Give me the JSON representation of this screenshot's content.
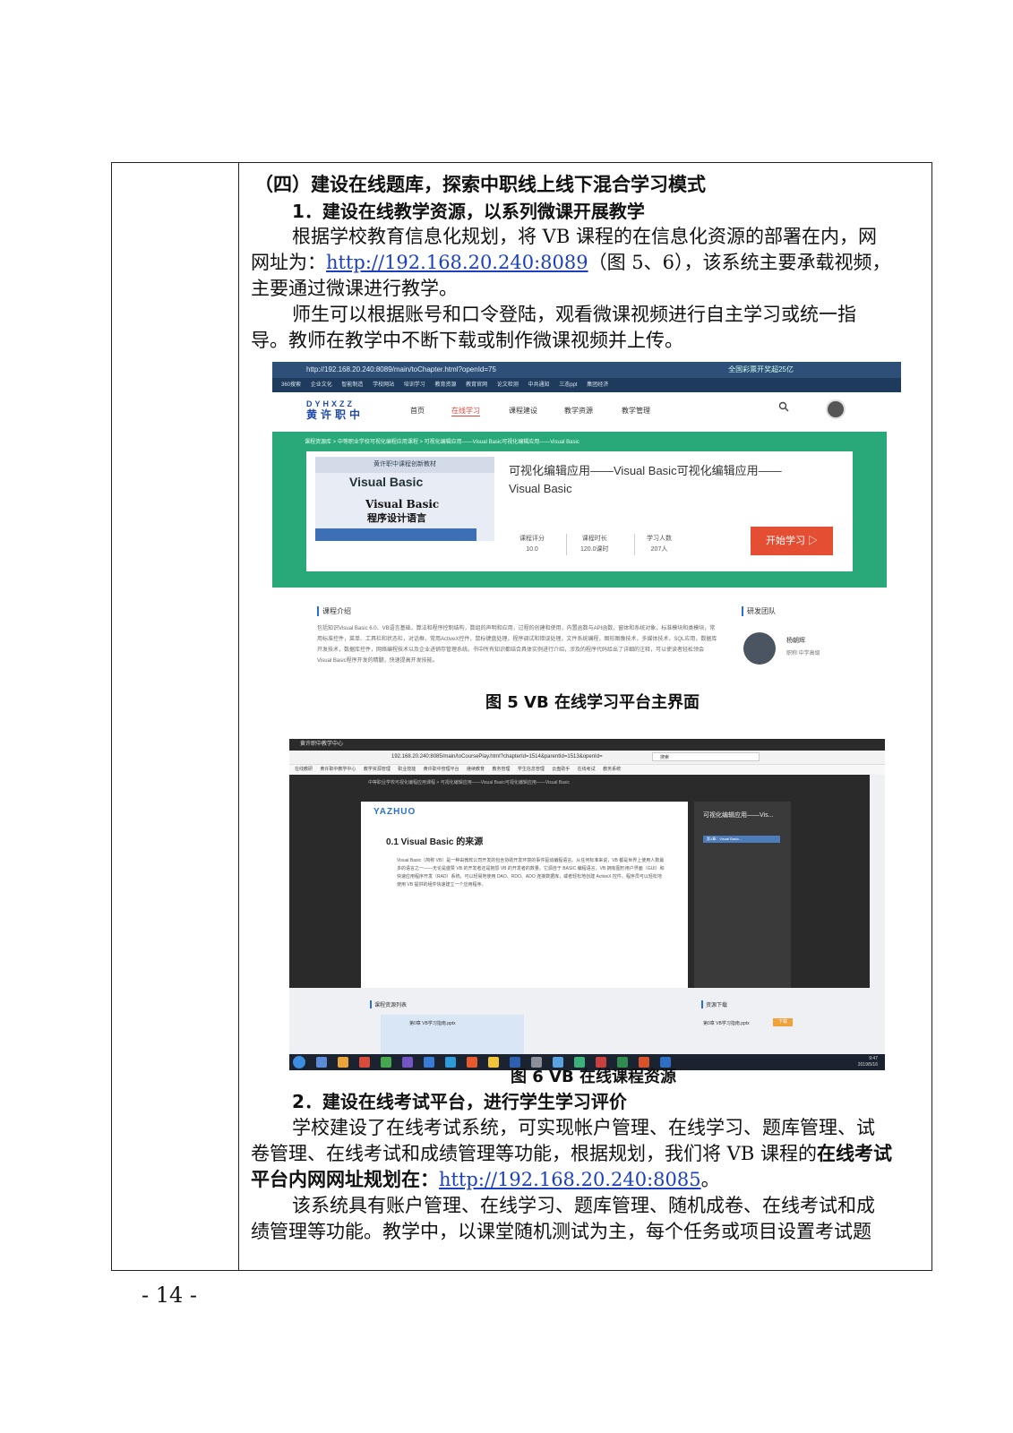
{
  "section_heading": "（四）建设在线题库，探索中职线上线下混合学习模式",
  "sub1_heading": "1．建设在线教学资源，以系列微课开展教学",
  "para1_line1": "根据学校教育信息化规划，将 VB 课程的在信息化资源的部署在内，网",
  "para1_line2_pre": "网址为：",
  "para1_link": "http://192.168.20.240:8089",
  "para1_line2_post": "（图 5、6），该系统主要承载视频，",
  "para1_line3": "主要通过微课进行教学。",
  "para2_line1": "师生可以根据账号和口令登陆，观看微课视频进行自主学习或统一指",
  "para2_line2": "导。教师在教学中不断下载或制作微课视频并上传。",
  "fig5": {
    "browser_url": "http://192.168.20.240:8089/main/toChapter.html?openId=75",
    "browser_right": "全国彩票开奖超25亿",
    "bookmarks": [
      "360搜索",
      "企业文化",
      "智能制造",
      "学校网站",
      "培训学习",
      "教育资源",
      "教育官网",
      "论文检测",
      "中共通知",
      "三态ppt",
      "集团经济"
    ],
    "logo_top": "DYHXZZ",
    "logo_bottom": "黄许职中",
    "nav": [
      "首页",
      "在线学习",
      "课程建设",
      "教学资源",
      "教学管理"
    ],
    "breadcrumb": "课程资源库 > 中等职业学校可视化编程应用课程 > 可视化编辑应用——Visual Basic可视化编辑应用——Visual Basic",
    "book_top": "黄许职中课程创新教材",
    "book_vb": "Visual Basic",
    "book_line2": "Visual Basic",
    "book_line3": "程序设计语言",
    "course_title": "可视化编辑应用——Visual Basic可视化编辑应用——Visual Basic",
    "stats": [
      {
        "label": "课程评分",
        "value": "10.0"
      },
      {
        "label": "课程时长",
        "value": "120.0课时"
      },
      {
        "label": "学习人数",
        "value": "207人"
      }
    ],
    "start_button": "开始学习 ▷",
    "intro_heading": "课程介绍",
    "intro_text": "包括知识Visual Basic 6.0、VB语言基础，算法和程序控制结构，数组的声明和应用，过程的创建和使用，内置函数与API函数，窗体和系统对象，标准模块和类模块，常用标准控件，菜单、工具栏和状态栏，对话框，常用ActiveX控件，鼠标键盘处理，程序调试和错误处理，文件系统编程，图形图像技术，多媒体技术，SQL应用，数据库开发技术，数据库控件，网络编程技术以及企业进销存管理系统。书中所有知识都结合具体实例进行介绍，涉及的程序代码给出了详细的注释，可以使读者轻松领会Visual Basic程序开发的精髓，快速提高开发技能。",
    "team_heading": "研发团队",
    "team_name": "杨朝辉",
    "team_role": "职称:中学高级"
  },
  "caption5": "图 5 VB 在线学习平台主界面",
  "fig6": {
    "tab": "黄许职中教学中心",
    "url": "192.168.20.240:8085/main/toCoursePlay.html?chapterId=1514&parentId=1513&openId=",
    "search_placeholder": "搜索",
    "bookmarks": [
      "在线教研",
      "黄许职中教学中心",
      "教学资源管理",
      "职业技能",
      "黄许职中管理平台",
      "继续教育",
      "教务管理",
      "学生信息管理",
      "云盘助手",
      "在线考试",
      "教务系统"
    ],
    "crumb": "中等职业学校可视化编程应用课程 > 可视化编辑应用——Visual Basic可视化编辑应用——Visual Basic",
    "slide_brand": "YAZHUO",
    "slide_title": "0.1  Visual Basic 的来源",
    "slide_text": "Visual Basic（简称 VB）是一种由微软公司开发的包含协助开发环境的事件驱动编程语言。从任何标准来说，VB 都是世界上使用人数最多的语言之一——无论是盛赞 VB 的开发者还是抱怨 VB 的开发者的数量。它源自于 BASIC 编程语言。VB 拥有图形用户界面（GUI）和快速应用程序开发（RAD）系统，可以轻易地使用 DAO、RDO、ADO 连接数据库，或者轻松地创建 ActiveX 控件。程序员可以轻松地使用 VB 提供的组件快速建立一个应用程序。",
    "side_title": "可视化编辑应用——Vis...",
    "side_item": "第1章：Visual Basic...",
    "res_heading": "课程资源列表",
    "res_file": "第0章 VB学习指南.pptx",
    "dl_heading": "资源下载",
    "dl_file": "第0章 VB学习指南.pptx",
    "dl_button": "下载",
    "clock_time": "9:47",
    "clock_date": "2019/5/16"
  },
  "caption6": "图 6 VB 在线课程资源",
  "sub2_heading": "2．建设在线考试平台，进行学生学习评价",
  "para3_line1": "学校建设了在线考试系统，可实现帐户管理、在线学习、题库管理、试",
  "para3_line2_pre": "卷管理、在线考试和成绩管理等功能，根据规划，我们将 VB 课程的",
  "para3_line2_bold": "在线考试",
  "para3_line3_bold": "平台内网网址规划在：",
  "para3_link": "http://192.168.20.240:8085",
  "para3_line3_post": "。",
  "para4_line1": "该系统具有账户管理、在线学习、题库管理、随机成卷、在线考试和成",
  "para4_line2": "绩管理等功能。教学中，以课堂随机测试为主，每个任务或项目设置考试题",
  "page_number": "- 14 -",
  "colors": {
    "banner_green": "#29a97a",
    "start_red": "#e44e32",
    "link_blue": "#1a3fbf"
  }
}
